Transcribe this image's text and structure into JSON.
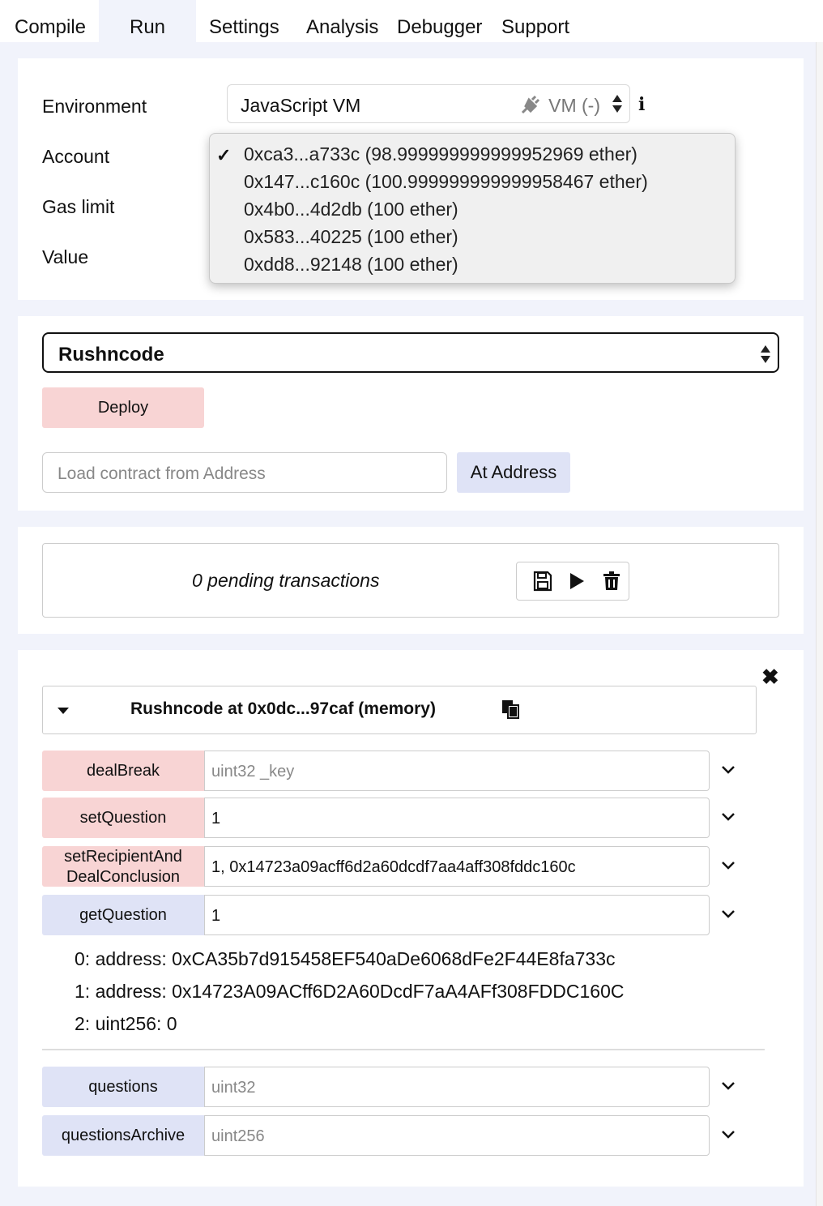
{
  "tabs": [
    "Compile",
    "Run",
    "Settings",
    "Analysis",
    "Debugger",
    "Support"
  ],
  "active_tab": "Run",
  "settings": {
    "environment_label": "Environment",
    "environment_value": "JavaScript VM",
    "environment_vm": "VM (-)",
    "account_label": "Account",
    "gas_limit_label": "Gas limit",
    "value_label": "Value"
  },
  "account_dropdown": {
    "selected_index": 0,
    "options": [
      "0xca3...a733c (98.999999999999952969 ether)",
      "0x147...c160c (100.999999999999958467 ether)",
      "0x4b0...4d2db (100 ether)",
      "0x583...40225 (100 ether)",
      "0xdd8...92148 (100 ether)"
    ]
  },
  "contract": {
    "selected": "Rushncode",
    "deploy_label": "Deploy",
    "address_placeholder": "Load contract from Address",
    "at_address_label": "At Address"
  },
  "pending": {
    "text": "0 pending transactions"
  },
  "instance": {
    "title": "Rushncode at 0x0dc...97caf (memory)",
    "functions": [
      {
        "name": "dealBreak",
        "kind": "transact",
        "value": "",
        "placeholder": "uint32 _key"
      },
      {
        "name": "setQuestion",
        "kind": "transact",
        "value": "1",
        "placeholder": ""
      },
      {
        "name_line1": "setRecipientAnd",
        "name_line2": "DealConclusion",
        "kind": "transact",
        "value": "1, 0x14723a09acff6d2a60dcdf7aa4aff308fddc160c",
        "placeholder": ""
      },
      {
        "name": "getQuestion",
        "kind": "call",
        "value": "1",
        "placeholder": ""
      },
      {
        "name": "questions",
        "kind": "call",
        "value": "",
        "placeholder": "uint32"
      },
      {
        "name": "questionsArchive",
        "kind": "call",
        "value": "",
        "placeholder": "uint256"
      }
    ],
    "results": [
      "0: address: 0xCA35b7d915458EF540aDe6068dFe2F44E8fa733c",
      "1: address: 0x14723A09ACff6D2A60DcdF7aA4AFf308FDDC160C",
      "2: uint256: 0"
    ]
  }
}
